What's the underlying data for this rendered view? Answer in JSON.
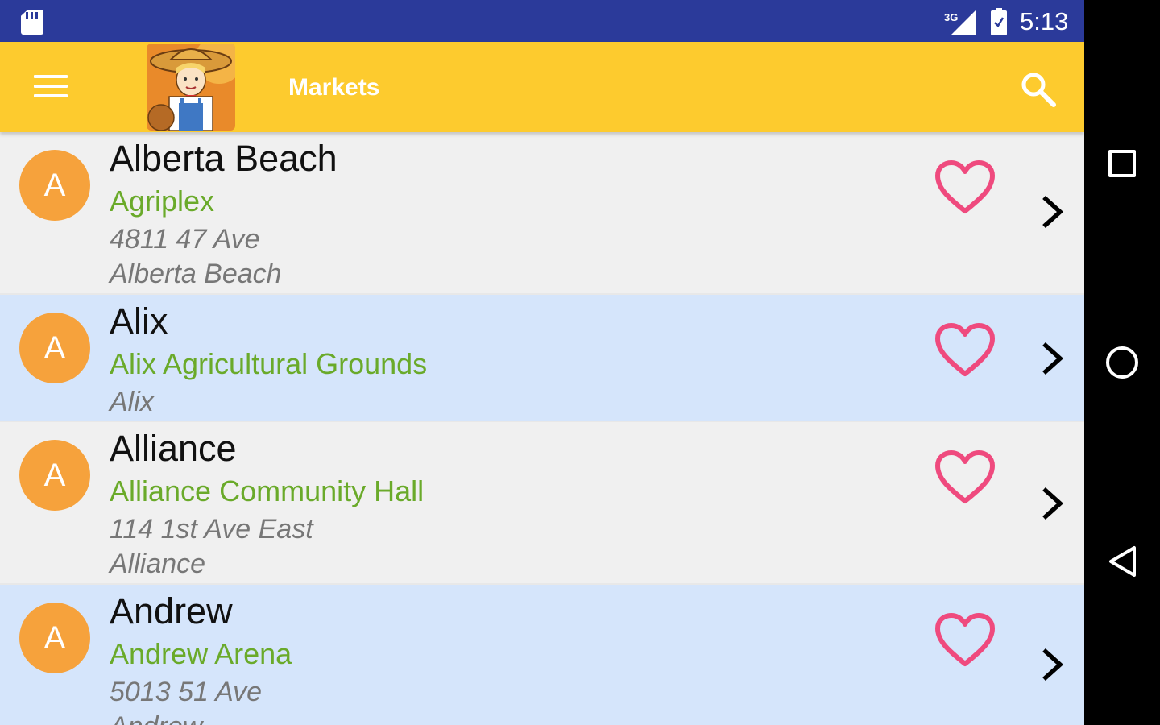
{
  "status_bar": {
    "network": "3G",
    "time": "5:13"
  },
  "toolbar": {
    "title": "Markets",
    "menu_icon": "hamburger-menu-icon",
    "search_icon": "search-icon",
    "logo": "farmer-logo"
  },
  "colors": {
    "status_bar": "#2b3a9a",
    "toolbar": "#fdcb2e",
    "avatar": "#f6a23c",
    "venue_text": "#6aaa2a",
    "heart": "#ef4a7e",
    "row_alt": "#d5e5fb",
    "row_base": "#f0f0f0"
  },
  "markets": [
    {
      "avatar": "A",
      "name": "Alberta Beach",
      "venue": "Agriplex",
      "address": "4811 47 Ave",
      "town": "Alberta Beach"
    },
    {
      "avatar": "A",
      "name": "Alix",
      "venue": "Alix Agricultural Grounds",
      "address": "",
      "town": "Alix"
    },
    {
      "avatar": "A",
      "name": "Alliance",
      "venue": "Alliance Community Hall",
      "address": "114 1st Ave East",
      "town": "Alliance"
    },
    {
      "avatar": "A",
      "name": "Andrew",
      "venue": "Andrew Arena",
      "address": "5013 51 Ave",
      "town": "Andrew"
    }
  ],
  "nav_bar": {
    "recent": "recent-apps-icon",
    "home": "home-icon",
    "back": "back-icon"
  }
}
